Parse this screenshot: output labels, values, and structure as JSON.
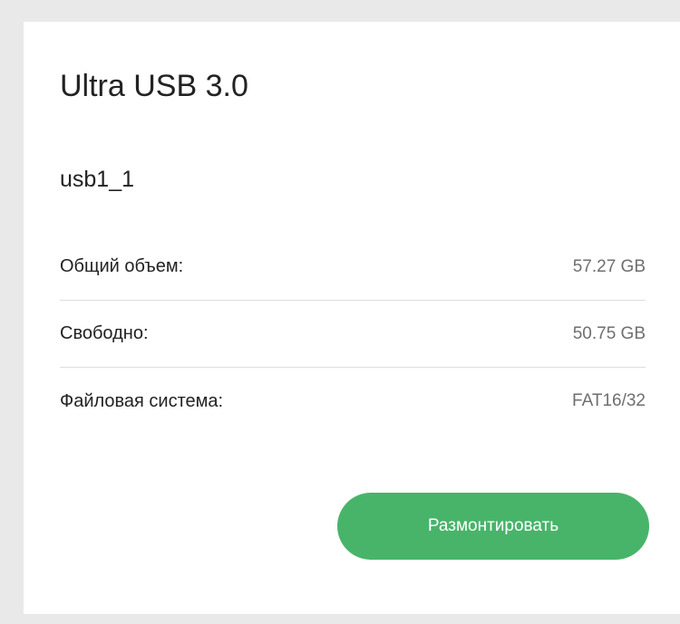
{
  "card": {
    "title": "Ultra USB 3.0",
    "device_name": "usb1_1",
    "info": [
      {
        "label": "Общий объем:",
        "value": "57.27 GB"
      },
      {
        "label": "Свободно:",
        "value": "50.75 GB"
      },
      {
        "label": "Файловая система:",
        "value": "FAT16/32"
      }
    ],
    "unmount_label": "Размонтировать"
  },
  "colors": {
    "button_background": "#48b46a",
    "page_background": "#e9e9e9",
    "card_background": "#ffffff"
  }
}
